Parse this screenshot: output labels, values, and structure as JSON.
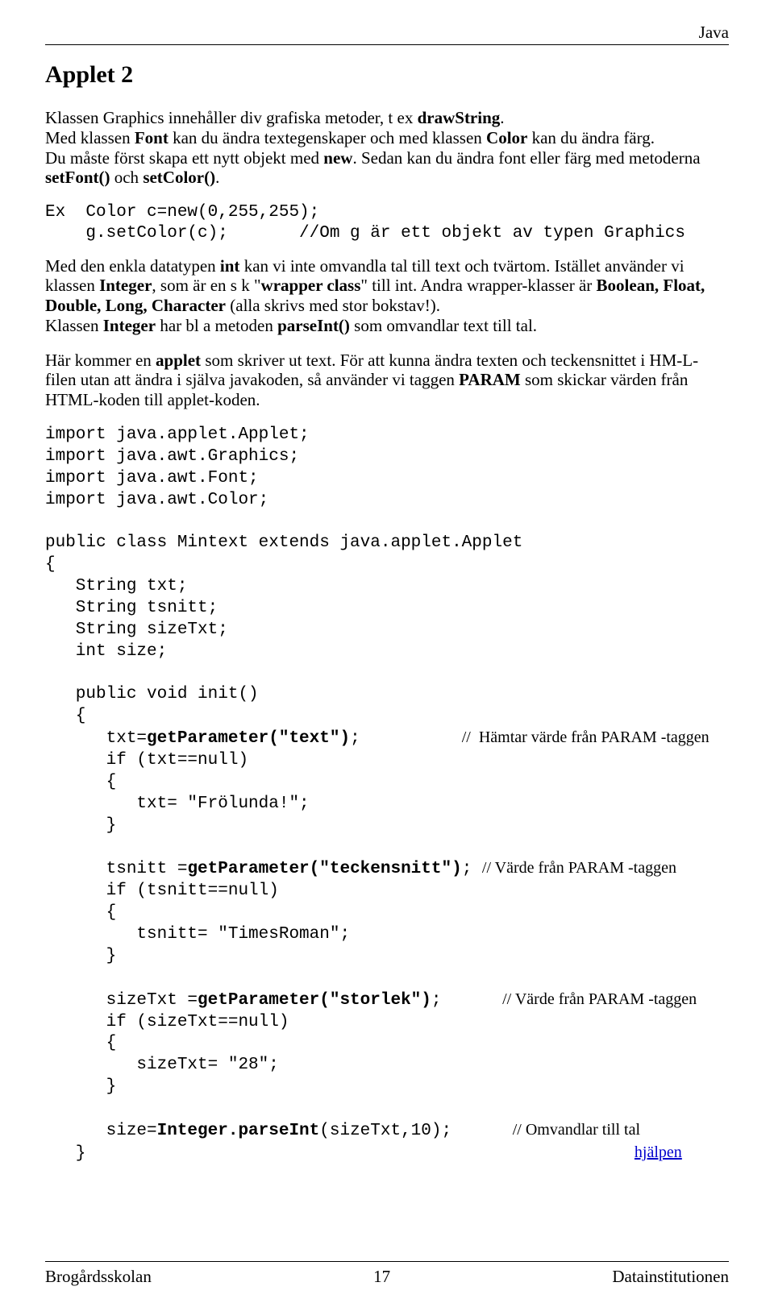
{
  "header": {
    "topRight": "Java"
  },
  "title": "Applet 2",
  "para1": {
    "t1": "Klassen Graphics innehåller div grafiska metoder, t ex ",
    "b1": "drawString",
    "t2": ".\nMed klassen ",
    "b2": "Font",
    "t3": " kan du ändra textegenskaper och med klassen ",
    "b3": "Color",
    "t4": " kan du ändra färg.\nDu måste först skapa ett nytt objekt med ",
    "b4": "new",
    "t5": ". Sedan kan du ändra font eller färg med metoderna\n",
    "b5": "setFont()",
    "t6": " och ",
    "b6": "setColor()",
    "t7": "."
  },
  "ex": {
    "line1": "Ex  Color c=new(0,255,255);",
    "line2": "    g.setColor(c);       //Om g är ett objekt av typen Graphics"
  },
  "para2": {
    "t1": "Med den enkla datatypen ",
    "b1": "int",
    "t2": " kan vi inte omvandla tal till text och tvärtom. Istället använder vi klassen ",
    "b2": "Integer",
    "t3": ", som är en s k \"",
    "b3": "wrapper class",
    "t4": "\" till int. Andra wrapper-klasser är ",
    "b4": "Boolean, Float, Double, Long, Character",
    "t5": " (alla skrivs med stor bokstav!).\nKlassen ",
    "b5": "Integer",
    "t6": " har bl a metoden ",
    "b6": "parseInt()",
    "t7": " som omvandlar text till tal."
  },
  "para3": {
    "t1": "Här kommer en ",
    "b1": "applet",
    "t2": " som skriver ut text. För att kunna ändra texten och teckensnittet i HM-L-filen utan att ändra i själva javakoden, så använder vi taggen ",
    "b2": "PARAM",
    "t3": " som skickar värden från HTML-koden till applet-koden."
  },
  "code": {
    "l01": "import java.applet.Applet;",
    "l02": "import java.awt.Graphics;",
    "l03": "import java.awt.Font;",
    "l04": "import java.awt.Color;",
    "gap1": " ",
    "l05": "public class Mintext extends java.applet.Applet",
    "l06": "{",
    "l07": "   String txt;",
    "l08": "   String tsnitt;",
    "l09": "   String sizeTxt;",
    "l10": "   int size;",
    "gap2": " ",
    "l11": "   public void init()",
    "l12": "   {",
    "l13a": "      txt=",
    "l13b": "getParameter(\"text\")",
    "l13c": ";          ",
    "l13cm": "//  Hämtar värde från PARAM -taggen",
    "l14": "      if (txt==null)",
    "l15": "      {",
    "l16": "         txt= \"Frölunda!\";",
    "l17": "      }",
    "gap3": " ",
    "l18a": "      tsnitt =",
    "l18b": "getParameter(\"teckensnitt\")",
    "l18c": "; ",
    "l18cm": "// Värde från PARAM -taggen",
    "l19": "      if (tsnitt==null)",
    "l20": "      {",
    "l21": "         tsnitt= \"TimesRoman\";",
    "l22": "      }",
    "gap4": " ",
    "l23a": "      sizeTxt =",
    "l23b": "getParameter(\"storlek\")",
    "l23c": ";      ",
    "l23cm": "// Värde från PARAM -taggen",
    "l24": "      if (sizeTxt==null)",
    "l25": "      {",
    "l26": "         sizeTxt= \"28\";",
    "l27": "      }",
    "gap5": " ",
    "l28a": "      size=",
    "l28b": "Integer.parseInt",
    "l28c": "(sizeTxt,10);      ",
    "l28cm": "// Omvandlar till tal",
    "l29a": "   }                                                      ",
    "l29link": "hjälpen"
  },
  "footer": {
    "left": "Brogårdsskolan",
    "center": "17",
    "right": "Datainstitutionen"
  }
}
